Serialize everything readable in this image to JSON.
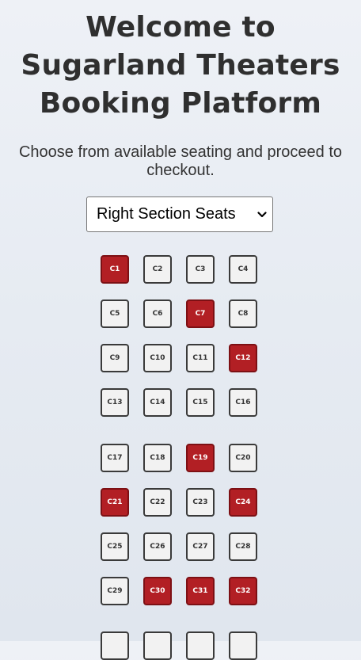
{
  "page": {
    "title": "Welcome to Sugarland Theaters Booking Platform",
    "subtitle": "Choose from available seating and proceed to checkout."
  },
  "section_select": {
    "selected": "Right Section Seats",
    "icon": "chevron-down-icon"
  },
  "colors": {
    "available_seat": "#f2f2f2",
    "taken_seat": "#b21f24",
    "seat_border": "#3a3a3a"
  },
  "seats": [
    {
      "label": "C1",
      "taken": true
    },
    {
      "label": "C2",
      "taken": false
    },
    {
      "label": "C3",
      "taken": false
    },
    {
      "label": "C4",
      "taken": false
    },
    {
      "label": "C5",
      "taken": false
    },
    {
      "label": "C6",
      "taken": false
    },
    {
      "label": "C7",
      "taken": true
    },
    {
      "label": "C8",
      "taken": false
    },
    {
      "label": "C9",
      "taken": false
    },
    {
      "label": "C10",
      "taken": false
    },
    {
      "label": "C11",
      "taken": false
    },
    {
      "label": "C12",
      "taken": true
    },
    {
      "label": "C13",
      "taken": false
    },
    {
      "label": "C14",
      "taken": false
    },
    {
      "label": "C15",
      "taken": false
    },
    {
      "label": "C16",
      "taken": false
    },
    {
      "label": "C17",
      "taken": false
    },
    {
      "label": "C18",
      "taken": false
    },
    {
      "label": "C19",
      "taken": true
    },
    {
      "label": "C20",
      "taken": false
    },
    {
      "label": "C21",
      "taken": true
    },
    {
      "label": "C22",
      "taken": false
    },
    {
      "label": "C23",
      "taken": false
    },
    {
      "label": "C24",
      "taken": true
    },
    {
      "label": "C25",
      "taken": false
    },
    {
      "label": "C26",
      "taken": false
    },
    {
      "label": "C27",
      "taken": false
    },
    {
      "label": "C28",
      "taken": false
    },
    {
      "label": "C29",
      "taken": false
    },
    {
      "label": "C30",
      "taken": true
    },
    {
      "label": "C31",
      "taken": true
    },
    {
      "label": "C32",
      "taken": true
    },
    {
      "label": "",
      "taken": false
    },
    {
      "label": "",
      "taken": false
    },
    {
      "label": "",
      "taken": false
    },
    {
      "label": "",
      "taken": false
    }
  ]
}
